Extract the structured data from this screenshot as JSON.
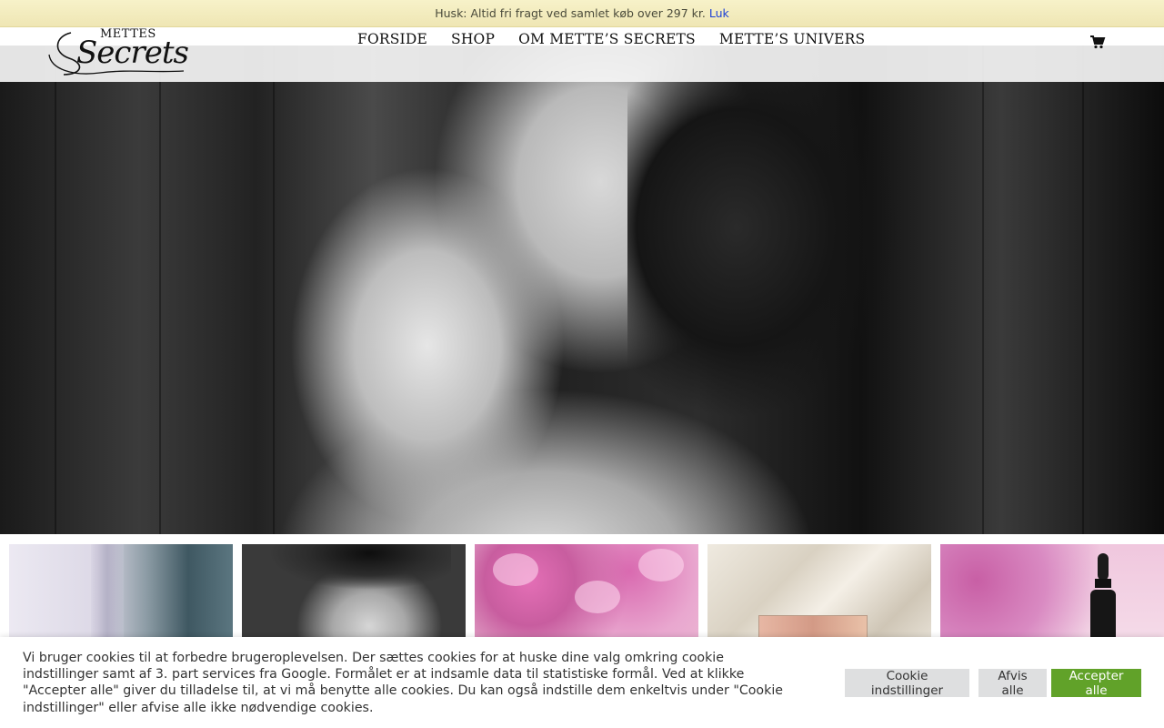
{
  "notice": {
    "text": "Husk: Altid fri fragt ved samlet køb over 297 kr.",
    "close_label": "Luk"
  },
  "header": {
    "logo_small": "METTES",
    "logo_script": "Secrets",
    "nav": [
      {
        "label": "FORSIDE"
      },
      {
        "label": "SHOP"
      },
      {
        "label": "OM METTE’S SECRETS"
      },
      {
        "label": "METTE’S UNIVERS"
      }
    ],
    "cart_icon": "shopping-cart-icon"
  },
  "hero": {
    "image_description_icon": "hero-image"
  },
  "thumbnails": [
    {
      "icon": "thumbnail-image"
    },
    {
      "icon": "thumbnail-image"
    },
    {
      "icon": "thumbnail-image"
    },
    {
      "icon": "thumbnail-image"
    },
    {
      "icon": "thumbnail-image"
    }
  ],
  "cookie": {
    "text": "Vi bruger cookies til at forbedre brugeroplevelsen. Der sættes cookies for at huske dine valg omkring cookie indstillinger samt af 3. part services fra Google. Formålet er at indsamle data til statistiske formål. Ved at klikke \"Accepter alle\" giver du tilladelse til, at vi må benytte alle cookies. Du kan også indstille dem enkeltvis under \"Cookie indstillinger\" eller afvise alle ikke nødvendige cookies.",
    "settings_label": "Cookie indstillinger",
    "reject_label": "Afvis alle",
    "accept_label": "Accepter alle"
  },
  "colors": {
    "notice_bg": "#f3ecc0",
    "link": "#1a3fd6",
    "accept_green": "#61a229",
    "button_grey": "#dedfe0"
  }
}
